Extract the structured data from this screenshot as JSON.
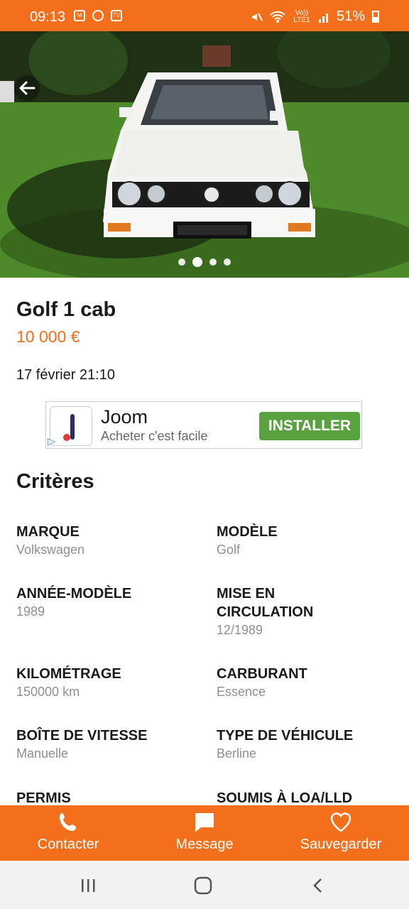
{
  "status_bar": {
    "time": "09:13",
    "battery": "51%",
    "network": "Vo)) LTE1"
  },
  "listing": {
    "title": "Golf 1 cab",
    "price": "10 000 €",
    "date": "17 février 21:10",
    "gallery": {
      "photo_count": 4,
      "active_index": 1
    }
  },
  "ad": {
    "brand": "Joom",
    "tagline": "Acheter c'est facile",
    "button": "INSTALLER"
  },
  "criteria": {
    "heading": "Critères",
    "items": [
      {
        "label": "MARQUE",
        "value": "Volkswagen"
      },
      {
        "label": "MODÈLE",
        "value": "Golf"
      },
      {
        "label": "ANNÉE-MODÈLE",
        "value": "1989"
      },
      {
        "label": "MISE EN CIRCULATION",
        "value": "12/1989"
      },
      {
        "label": "KILOMÉTRAGE",
        "value": "150000 km"
      },
      {
        "label": "CARBURANT",
        "value": "Essence"
      },
      {
        "label": "BOÎTE DE VITESSE",
        "value": "Manuelle"
      },
      {
        "label": "TYPE DE VÉHICULE",
        "value": "Berline"
      },
      {
        "label": "PERMIS",
        "value": ""
      },
      {
        "label": "SOUMIS À LOA/LLD",
        "value": ""
      }
    ]
  },
  "actions": {
    "contact": "Contacter",
    "message": "Message",
    "save": "Sauvegarder"
  },
  "colors": {
    "brand": "#f36f1c",
    "ad_button": "#5aa23f"
  }
}
